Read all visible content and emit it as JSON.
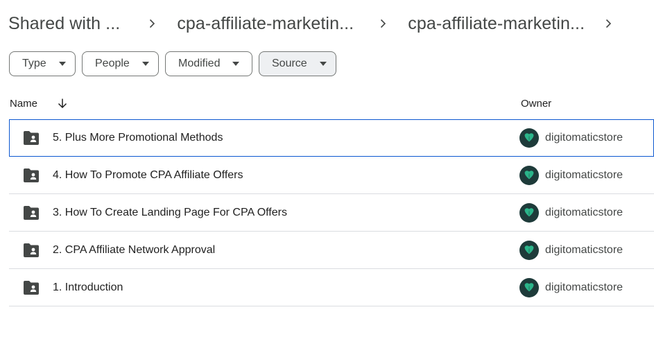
{
  "breadcrumb": {
    "items": [
      "Shared with ...",
      "cpa-affiliate-marketin...",
      "cpa-affiliate-marketin..."
    ]
  },
  "filters": [
    {
      "label": "Type"
    },
    {
      "label": "People"
    },
    {
      "label": "Modified"
    },
    {
      "label": "Source"
    }
  ],
  "columns": {
    "name": "Name",
    "owner": "Owner"
  },
  "rows": [
    {
      "name": "5. Plus More Promotional Methods",
      "owner": "digitomaticstore"
    },
    {
      "name": "4. How To Promote CPA Affiliate Offers",
      "owner": "digitomaticstore"
    },
    {
      "name": "3. How To Create Landing Page For CPA Offers",
      "owner": "digitomaticstore"
    },
    {
      "name": "2. CPA Affiliate Network Approval",
      "owner": "digitomaticstore"
    },
    {
      "name": "1. Introduction",
      "owner": "digitomaticstore"
    }
  ],
  "icons": {
    "breadcrumb_separator": "chevron-right-icon",
    "filter_caret": "caret-down-icon",
    "sort": "arrow-down-icon",
    "row_type": "shared-folder-icon",
    "avatar": "owner-avatar-logo"
  },
  "colors": {
    "selection_border": "#0b57d0",
    "avatar_bg": "#1e3b3a",
    "avatar_mark": "#2bb58a",
    "active_chip_bg": "#eef0f2"
  }
}
